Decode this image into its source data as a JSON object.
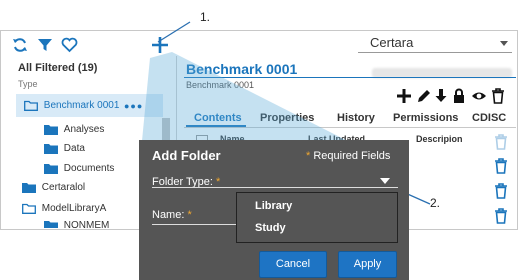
{
  "callouts": {
    "one": "1.",
    "two": "2."
  },
  "toolbar": {
    "project_select": "Certara",
    "icons": [
      "refresh-icon",
      "filter-icon",
      "heart-icon",
      "plus-icon"
    ]
  },
  "left_pane": {
    "title": "All Filtered (19)",
    "subtitle": "Type",
    "tree": [
      {
        "label": "Benchmark 0001",
        "selected": true
      },
      {
        "label": "Analyses"
      },
      {
        "label": "Data"
      },
      {
        "label": "Documents"
      },
      {
        "label": "Certaralol"
      },
      {
        "label": "ModelLibraryA"
      },
      {
        "label": "NONMEM"
      }
    ],
    "more_dots": "●●●"
  },
  "right_pane": {
    "title": "Benchmark 0001",
    "subtitle": "Benchmark 0001",
    "tabs": [
      "Contents",
      "Properties",
      "History",
      "Permissions",
      "CDISC"
    ],
    "columns": [
      "Name",
      "Last Updated",
      "Descripion"
    ]
  },
  "dialog": {
    "title": "Add Folder",
    "required_star": "*",
    "required_text": "Required Fields",
    "folder_type_label": "Folder Type:",
    "name_label": "Name:",
    "options": [
      "Library",
      "Study"
    ],
    "cancel": "Cancel",
    "apply": "Apply"
  },
  "colors": {
    "accent": "#1b75bc",
    "dialog_bg": "#555555",
    "button": "#1e74c4",
    "required_star": "#f0a830"
  }
}
